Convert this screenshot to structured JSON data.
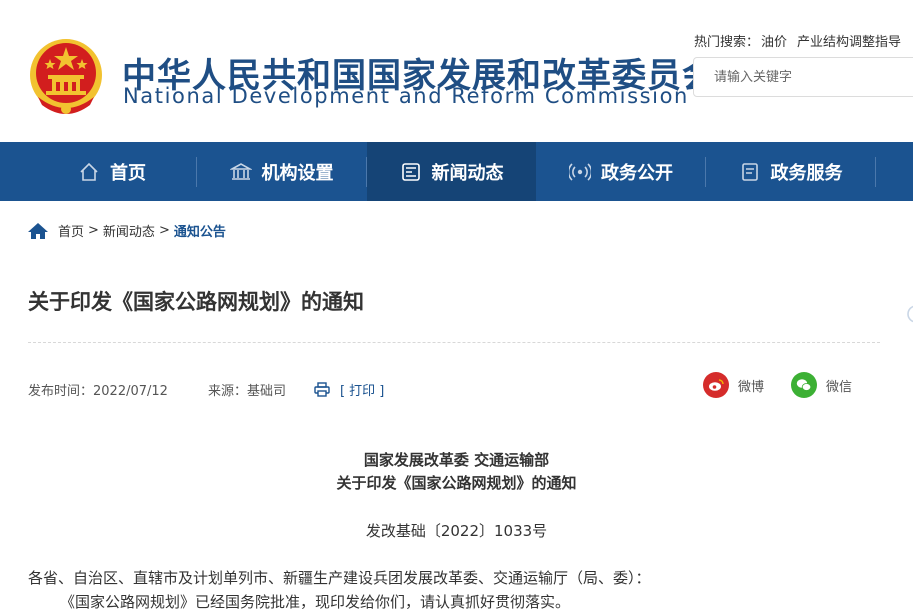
{
  "header": {
    "title_cn": "中华人民共和国国家发展和改革委员会",
    "title_en": "National Development and Reform Commission",
    "hot_search_label": "热门搜索：",
    "hot_search_items": [
      "油价",
      "产业结构调整指导"
    ],
    "search_placeholder": "请输入关键字"
  },
  "nav": {
    "items": [
      {
        "label": "首页",
        "icon": "home-icon"
      },
      {
        "label": "机构设置",
        "icon": "building-icon"
      },
      {
        "label": "新闻动态",
        "icon": "news-icon"
      },
      {
        "label": "政务公开",
        "icon": "broadcast-icon"
      },
      {
        "label": "政务服务",
        "icon": "document-icon"
      }
    ],
    "active_index": 2
  },
  "breadcrumb": {
    "items": [
      "首页",
      "新闻动态",
      "通知公告"
    ],
    "separator": ">"
  },
  "article": {
    "title": "关于印发《国家公路网规划》的通知",
    "publish_time": "发布时间：2022/07/12",
    "source": "来源：基础司",
    "print_label": "[ 打印 ]",
    "share": [
      {
        "label": "微博",
        "icon": "weibo-icon",
        "color": "#d52c2b"
      },
      {
        "label": "微信",
        "icon": "wechat-icon",
        "color": "#3cb034"
      }
    ],
    "doc_heading_1": "国家发展改革委 交通运输部",
    "doc_heading_2": "关于印发《国家公路网规划》的通知",
    "doc_number": "发改基础〔2022〕1033号",
    "recipients": "各省、自治区、直辖市及计划单列市、新疆生产建设兵团发展改革委、交通运输厅（局、委）：",
    "body_line_1": "《国家公路网规划》已经国务院批准，现印发给你们，请认真抓好贯彻落实。"
  },
  "colors": {
    "brand_blue": "#1b5390",
    "nav_active": "#154476",
    "emblem_red": "#d21e1e",
    "emblem_gold": "#f2c230"
  }
}
